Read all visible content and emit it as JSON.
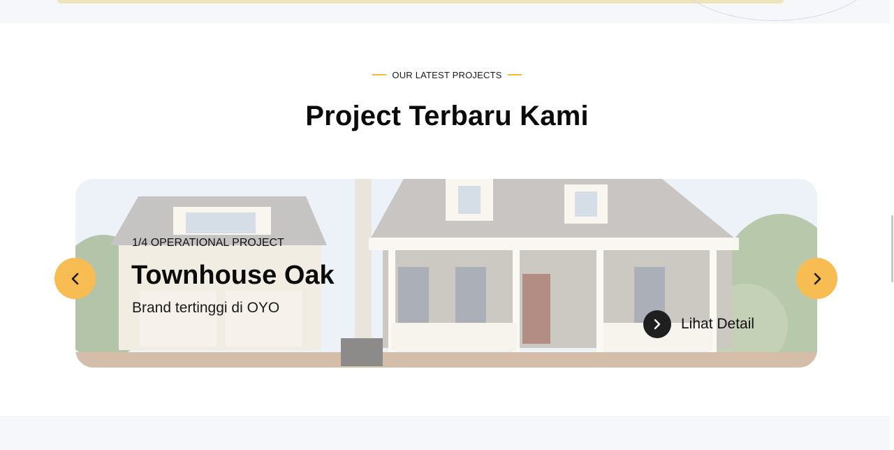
{
  "section": {
    "eyebrow": "OUR LATEST PROJECTS",
    "title": "Project Terbaru Kami"
  },
  "carousel": {
    "slide": {
      "counter": "1/4 OPERATIONAL PROJECT",
      "title": "Townhouse Oak",
      "description": "Brand tertinggi di OYO",
      "detail_label": "Lihat Detail"
    },
    "prev_icon": "chevron-left-icon",
    "next_icon": "chevron-right-icon",
    "detail_icon": "chevron-right-icon"
  },
  "colors": {
    "accent": "#f7bc52",
    "accent_line": "#f2b93b",
    "dark": "#1f1f1f",
    "section_bg": "#f6f7fb"
  }
}
